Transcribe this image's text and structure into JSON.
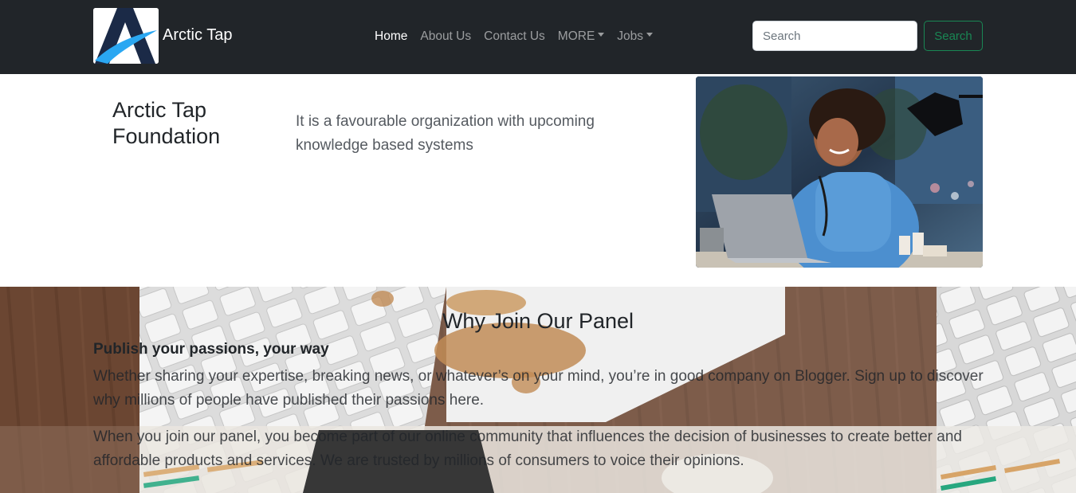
{
  "brand": {
    "name": "Arctic Tap",
    "logo_icon": "arctic-tap-logo"
  },
  "nav": {
    "items": [
      {
        "label": "Home",
        "active": true,
        "dropdown": false
      },
      {
        "label": "About Us",
        "active": false,
        "dropdown": false
      },
      {
        "label": "Contact Us",
        "active": false,
        "dropdown": false
      },
      {
        "label": "MORE",
        "active": false,
        "dropdown": true
      },
      {
        "label": "Jobs",
        "active": false,
        "dropdown": true
      }
    ],
    "search": {
      "placeholder": "Search",
      "value": "",
      "button_label": "Search"
    }
  },
  "hero": {
    "title": "Arctic Tap Foundation",
    "description": "It is a favourable organization with upcoming knowledge based systems",
    "image_alt": "smiling doctor working on laptop"
  },
  "panel": {
    "title": "Why Join Our Panel",
    "subtitle": "Publish your passions, your way",
    "paragraph1": "Whether sharing your expertise, breaking news, or whatever’s on your mind, you’re in good company on Blogger. Sign up to discover why millions of people have published their passions here.",
    "paragraph2": "When you join our panel, you become part of our online community that influences the decision of businesses to create better and affordable products and services. We are trusted by millions of consumers to voice their opinions."
  },
  "colors": {
    "navbar": "#212529",
    "success": "#198754",
    "text": "#212529"
  }
}
